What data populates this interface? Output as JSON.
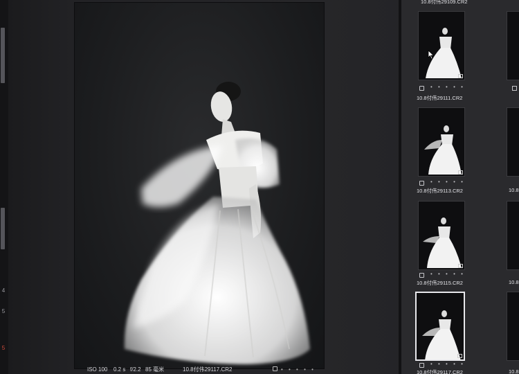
{
  "viewer": {
    "iso": "ISO 100",
    "shutter": "0.2 s",
    "aperture": "f/2.2",
    "focal": "85 毫米",
    "filename": "10.8付伟29117.CR2",
    "rating_dots": "• • • • •"
  },
  "filmstrip": {
    "top_name": "10.8付伟29109.CR2",
    "thumbs": [
      {
        "name": "10.8付伟29111.CR2",
        "dots": "• • • • •"
      },
      {
        "name": "10.8付伟29113.CR2",
        "dots": "• • • • •"
      },
      {
        "name": "10.8付伟29115.CR2",
        "dots": "• • • • •"
      },
      {
        "name": "10.8付伟29117.CR2",
        "dots": "• • • • •"
      }
    ],
    "column2_names": [
      "10.8",
      "10.8",
      "10.8"
    ]
  },
  "left_strip": {
    "glyph_a": "4",
    "glyph_b": "5",
    "glyph_c": "5"
  },
  "colors": {
    "accent": "#e8e8ec",
    "background": "#1c1c1e",
    "mark": "#d04a3a"
  }
}
